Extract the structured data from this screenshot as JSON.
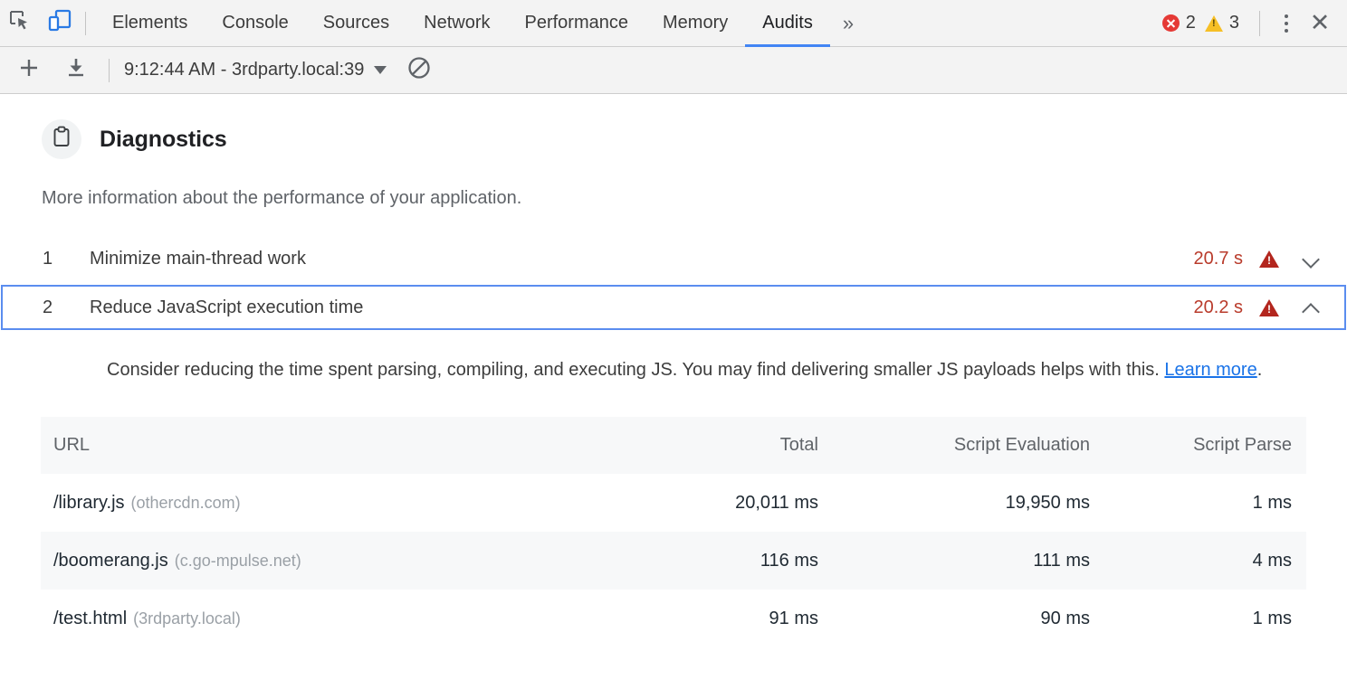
{
  "devtools": {
    "icons": {
      "inspect": "inspect-element-icon",
      "device": "device-toolbar-icon",
      "more_tabs": "»",
      "close": "✕"
    },
    "tabs": [
      {
        "label": "Elements",
        "active": false
      },
      {
        "label": "Console",
        "active": false
      },
      {
        "label": "Sources",
        "active": false
      },
      {
        "label": "Network",
        "active": false
      },
      {
        "label": "Performance",
        "active": false
      },
      {
        "label": "Memory",
        "active": false
      },
      {
        "label": "Audits",
        "active": true
      }
    ],
    "counters": {
      "errors": "2",
      "warnings": "3"
    },
    "colors": {
      "accent_blue": "#4285f4",
      "error_red": "#e53935",
      "warning_amber": "#f6bf26",
      "fail_red": "#b3261e",
      "link_blue": "#1a73e8"
    }
  },
  "audit_toolbar": {
    "add_label": "+",
    "add_name": "new-audit-icon",
    "export_name": "export-report-icon",
    "run_selected": "9:12:44 AM - 3rdparty.local:39",
    "clear_name": "clear-all-icon"
  },
  "category": {
    "icon": "clipboard-icon",
    "title": "Diagnostics",
    "description": "More information about the performance of your application."
  },
  "audits": [
    {
      "index": "1",
      "title": "Minimize main-thread work",
      "score": "20.7 s",
      "state": "fail",
      "expanded": false,
      "chevron": "chevron-down-icon"
    },
    {
      "index": "2",
      "title": "Reduce JavaScript execution time",
      "score": "20.2 s",
      "state": "fail",
      "expanded": true,
      "chevron": "chevron-up-icon",
      "detail": {
        "text_before": "Consider reducing the time spent parsing, compiling, and executing JS. You may find delivering smaller JS payloads helps with this. ",
        "link_label": "Learn more",
        "text_after": "."
      }
    }
  ],
  "table": {
    "columns": [
      "URL",
      "Total",
      "Script Evaluation",
      "Script Parse"
    ],
    "rows": [
      {
        "url": "/library.js",
        "host": "(othercdn.com)",
        "total": "20,011 ms",
        "evaluation": "19,950 ms",
        "parse": "1 ms"
      },
      {
        "url": "/boomerang.js",
        "host": "(c.go-mpulse.net)",
        "total": "116 ms",
        "evaluation": "111 ms",
        "parse": "4 ms"
      },
      {
        "url": "/test.html",
        "host": "(3rdparty.local)",
        "total": "91 ms",
        "evaluation": "90 ms",
        "parse": "1 ms"
      }
    ]
  }
}
